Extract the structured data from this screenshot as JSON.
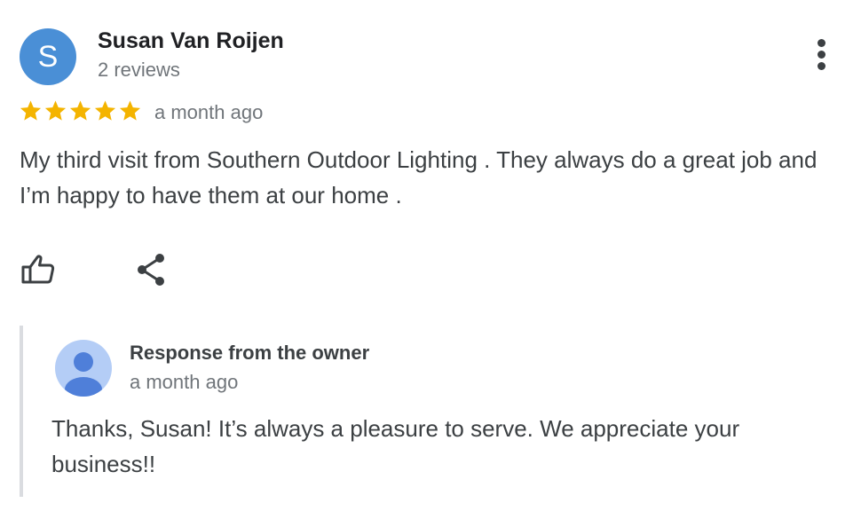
{
  "review": {
    "avatar_initial": "S",
    "reviewer_name": "Susan Van Roijen",
    "reviewer_review_count": "2 reviews",
    "rating": 5,
    "rating_max": 5,
    "time": "a month ago",
    "text": "My third visit from Southern Outdoor Lighting . They always do a great job and I’m happy to have them at our home ."
  },
  "owner_response": {
    "label": "Response from the owner",
    "time": "a month ago",
    "text": "Thanks, Susan! It’s always a pleasure to serve. We appreciate your business!!"
  },
  "icons": {
    "more": "more-vert-icon",
    "like": "thumb-up-icon",
    "share": "share-icon",
    "star": "star-icon",
    "owner_avatar": "person-icon"
  },
  "colors": {
    "avatar_bg": "#4a8fd6",
    "star": "#f4b400",
    "owner_avatar_bg": "#b4cdf6",
    "owner_avatar_figure": "#4f7fd9"
  }
}
